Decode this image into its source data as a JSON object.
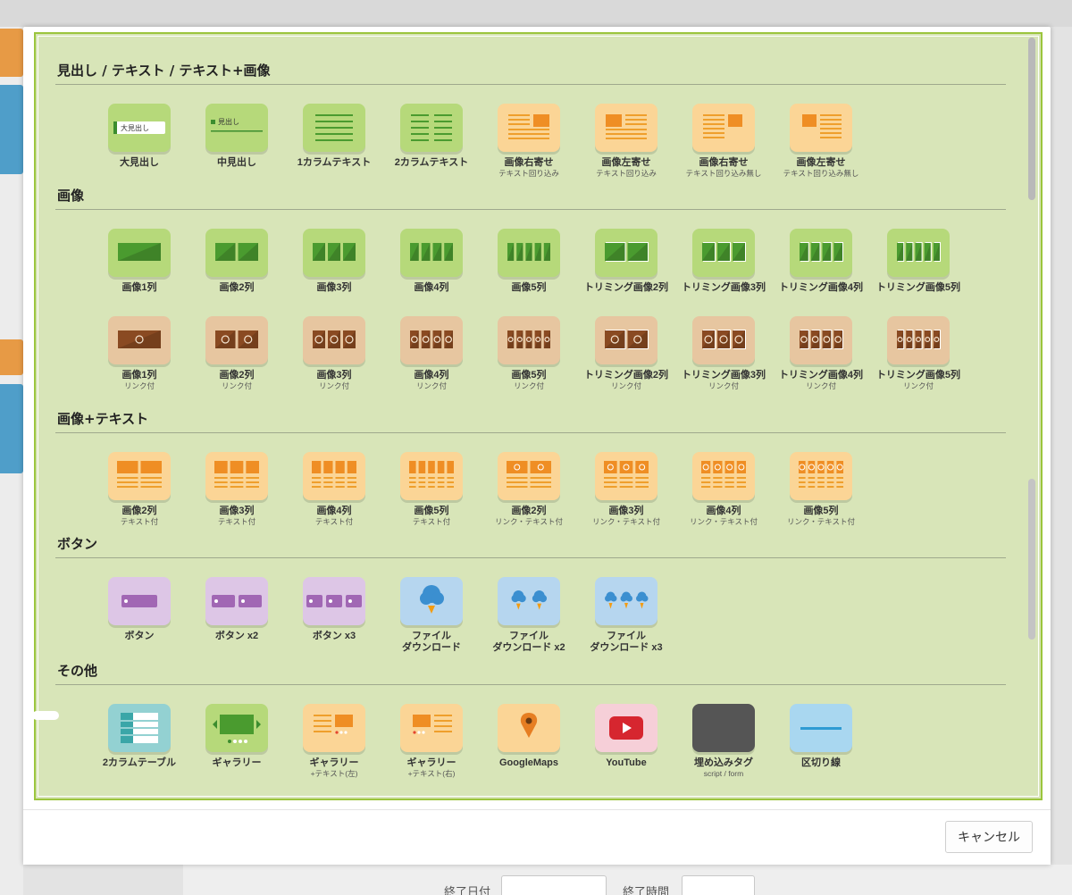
{
  "sections": [
    {
      "title": "見出し / テキスト / テキスト+画像",
      "items": [
        {
          "label": "大見出し",
          "sub": "",
          "icon": "large-heading-icon",
          "tile_text": "大見出し"
        },
        {
          "label": "中見出し",
          "sub": "",
          "icon": "medium-heading-icon",
          "tile_text": "見出し"
        },
        {
          "label": "1カラムテキスト",
          "sub": "",
          "icon": "one-column-text-icon"
        },
        {
          "label": "2カラムテキスト",
          "sub": "",
          "icon": "two-column-text-icon"
        },
        {
          "label": "画像右寄せ",
          "sub": "テキスト回り込み",
          "icon": "image-right-wrap-icon"
        },
        {
          "label": "画像左寄せ",
          "sub": "テキスト回り込み",
          "icon": "image-left-wrap-icon"
        },
        {
          "label": "画像右寄せ",
          "sub": "テキスト回り込み無し",
          "icon": "image-right-nowrap-icon"
        },
        {
          "label": "画像左寄せ",
          "sub": "テキスト回り込み無し",
          "icon": "image-left-nowrap-icon"
        }
      ]
    },
    {
      "title": "画像",
      "items": [
        {
          "label": "画像1列",
          "sub": "",
          "icon": "image-1col-icon"
        },
        {
          "label": "画像2列",
          "sub": "",
          "icon": "image-2col-icon"
        },
        {
          "label": "画像3列",
          "sub": "",
          "icon": "image-3col-icon"
        },
        {
          "label": "画像4列",
          "sub": "",
          "icon": "image-4col-icon"
        },
        {
          "label": "画像5列",
          "sub": "",
          "icon": "image-5col-icon"
        },
        {
          "label": "トリミング画像2列",
          "sub": "",
          "icon": "trim-image-2col-icon"
        },
        {
          "label": "トリミング画像3列",
          "sub": "",
          "icon": "trim-image-3col-icon"
        },
        {
          "label": "トリミング画像4列",
          "sub": "",
          "icon": "trim-image-4col-icon"
        },
        {
          "label": "トリミング画像5列",
          "sub": "",
          "icon": "trim-image-5col-icon"
        },
        {
          "label": "画像1列",
          "sub": "リンク付",
          "icon": "image-1col-link-icon"
        },
        {
          "label": "画像2列",
          "sub": "リンク付",
          "icon": "image-2col-link-icon"
        },
        {
          "label": "画像3列",
          "sub": "リンク付",
          "icon": "image-3col-link-icon"
        },
        {
          "label": "画像4列",
          "sub": "リンク付",
          "icon": "image-4col-link-icon"
        },
        {
          "label": "画像5列",
          "sub": "リンク付",
          "icon": "image-5col-link-icon"
        },
        {
          "label": "トリミング画像2列",
          "sub": "リンク付",
          "icon": "trim-image-2col-link-icon"
        },
        {
          "label": "トリミング画像3列",
          "sub": "リンク付",
          "icon": "trim-image-3col-link-icon"
        },
        {
          "label": "トリミング画像4列",
          "sub": "リンク付",
          "icon": "trim-image-4col-link-icon"
        },
        {
          "label": "トリミング画像5列",
          "sub": "リンク付",
          "icon": "trim-image-5col-link-icon"
        }
      ]
    },
    {
      "title": "画像+テキスト",
      "items": [
        {
          "label": "画像2列",
          "sub": "テキスト付",
          "icon": "image-text-2col-icon"
        },
        {
          "label": "画像3列",
          "sub": "テキスト付",
          "icon": "image-text-3col-icon"
        },
        {
          "label": "画像4列",
          "sub": "テキスト付",
          "icon": "image-text-4col-icon"
        },
        {
          "label": "画像5列",
          "sub": "テキスト付",
          "icon": "image-text-5col-icon"
        },
        {
          "label": "画像2列",
          "sub": "リンク・テキスト付",
          "icon": "image-link-text-2col-icon"
        },
        {
          "label": "画像3列",
          "sub": "リンク・テキスト付",
          "icon": "image-link-text-3col-icon"
        },
        {
          "label": "画像4列",
          "sub": "リンク・テキスト付",
          "icon": "image-link-text-4col-icon"
        },
        {
          "label": "画像5列",
          "sub": "リンク・テキスト付",
          "icon": "image-link-text-5col-icon"
        }
      ]
    },
    {
      "title": "ボタン",
      "items": [
        {
          "label": "ボタン",
          "sub": "",
          "icon": "button-icon"
        },
        {
          "label": "ボタン x2",
          "sub": "",
          "icon": "button-x2-icon"
        },
        {
          "label": "ボタン x3",
          "sub": "",
          "icon": "button-x3-icon"
        },
        {
          "label": "ファイル",
          "label2": "ダウンロード",
          "sub": "",
          "icon": "file-download-icon"
        },
        {
          "label": "ファイル",
          "label2": "ダウンロード x2",
          "sub": "",
          "icon": "file-download-x2-icon"
        },
        {
          "label": "ファイル",
          "label2": "ダウンロード x3",
          "sub": "",
          "icon": "file-download-x3-icon"
        }
      ]
    },
    {
      "title": "その他",
      "items": [
        {
          "label": "2カラムテーブル",
          "sub": "",
          "icon": "two-column-table-icon"
        },
        {
          "label": "ギャラリー",
          "sub": "",
          "icon": "gallery-icon"
        },
        {
          "label": "ギャラリー",
          "sub": "+テキスト(左)",
          "icon": "gallery-text-left-icon"
        },
        {
          "label": "ギャラリー",
          "sub": "+テキスト(右)",
          "icon": "gallery-text-right-icon"
        },
        {
          "label": "GoogleMaps",
          "sub": "",
          "icon": "google-maps-icon"
        },
        {
          "label": "YouTube",
          "sub": "",
          "icon": "youtube-icon"
        },
        {
          "label": "埋め込みタグ",
          "sub": "script / form",
          "icon": "embed-tag-icon",
          "tile_text": "</>"
        },
        {
          "label": "区切り線",
          "sub": "",
          "icon": "divider-line-icon"
        }
      ]
    }
  ],
  "footer": {
    "cancel_label": "キャンセル"
  },
  "background": {
    "end_date_label": "終了日付",
    "end_time_label": "終了時間"
  },
  "colors": {
    "panel_bg": "#d8e5b8",
    "panel_border": "#9bc53d",
    "green_tile": "#b6d97a",
    "orange_tile": "#fbd596",
    "brown_tile": "#e7c6a0"
  }
}
